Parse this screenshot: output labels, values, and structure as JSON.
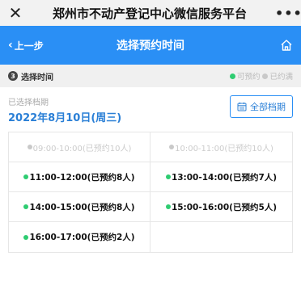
{
  "wechat_bar": {
    "close_glyph": "✕",
    "title": "郑州市不动产登记中心微信服务平台",
    "more_glyph": "•••"
  },
  "header": {
    "back_label": "上一步",
    "title": "选择预约时间",
    "home_icon": "home-icon",
    "bg_color": "#2a8ff5"
  },
  "step": {
    "number": "3",
    "label": "选择时间",
    "legend_available": "可预约",
    "legend_full": "已约满",
    "available_color": "#2ecc71",
    "full_color": "#c9c9c9"
  },
  "date": {
    "label": "已选择档期",
    "value": "2022年8月10日(周三)",
    "all_button": "全部档期",
    "calendar_icon": "calendar-icon"
  },
  "slots": [
    {
      "text": "09:00-10:00(已预约10人)",
      "status": "full"
    },
    {
      "text": "10:00-11:00(已预约10人)",
      "status": "full"
    },
    {
      "text": "11:00-12:00(已预约8人)",
      "status": "open"
    },
    {
      "text": "13:00-14:00(已预约7人)",
      "status": "open"
    },
    {
      "text": "14:00-15:00(已预约8人)",
      "status": "open"
    },
    {
      "text": "15:00-16:00(已预约5人)",
      "status": "open"
    },
    {
      "text": "16:00-17:00(已预约2人)",
      "status": "open"
    },
    {
      "text": "",
      "status": "empty"
    }
  ]
}
